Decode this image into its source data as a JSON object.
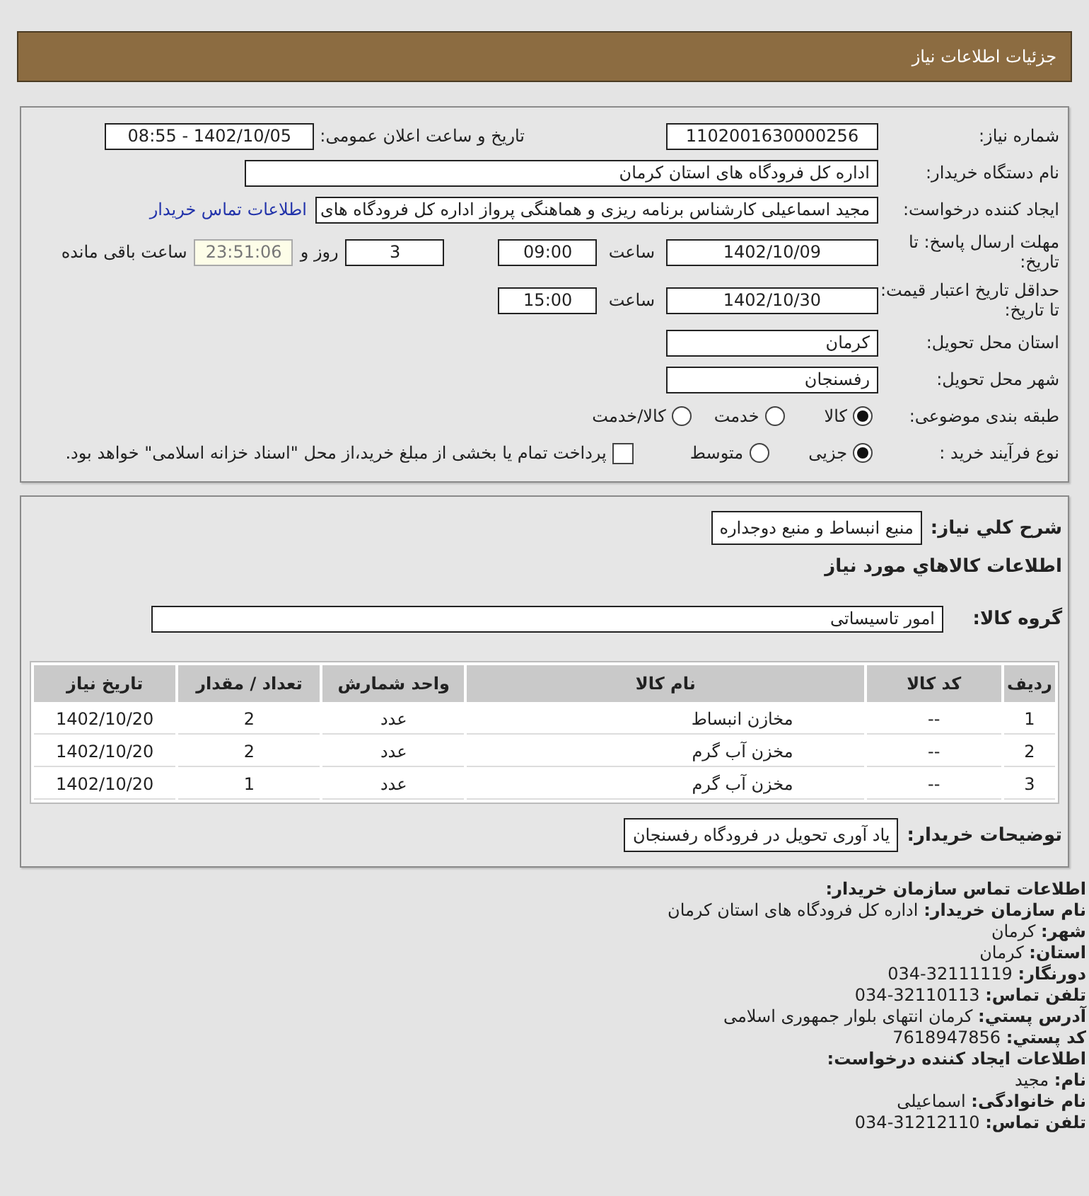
{
  "header": {
    "title": "جزئیات اطلاعات نیاز"
  },
  "details": {
    "need_number": {
      "label": "شماره نیاز:",
      "value": "1102001630000256"
    },
    "announce": {
      "label": "تاریخ و ساعت اعلان عمومی:",
      "value": "1402/10/05 - 08:55"
    },
    "buyer_org": {
      "label": "نام دستگاه خریدار:",
      "value": "اداره کل فرودگاه های استان کرمان"
    },
    "creator": {
      "label": "ایجاد کننده درخواست:",
      "value": "مجید اسماعیلی کارشناس برنامه ریزی و هماهنگی پرواز اداره کل فرودگاه های",
      "link": "اطلاعات تماس خریدار"
    },
    "deadline": {
      "label": "مهلت ارسال پاسخ: تا تاریخ:",
      "date": "1402/10/09",
      "time_label": "ساعت",
      "time": "09:00",
      "days": "3",
      "days_label": "روز و",
      "remaining": "23:51:06",
      "remaining_label": "ساعت باقی مانده"
    },
    "validity": {
      "label": "حداقل تاریخ اعتبار قیمت: تا تاریخ:",
      "date": "1402/10/30",
      "time_label": "ساعت",
      "time": "15:00"
    },
    "province": {
      "label": "استان محل تحویل:",
      "value": "کرمان"
    },
    "city": {
      "label": "شهر محل تحویل:",
      "value": "رفسنجان"
    },
    "category": {
      "label": "طبقه بندی موضوعی:",
      "options": [
        {
          "label": "کالا",
          "selected": true
        },
        {
          "label": "خدمت",
          "selected": false
        },
        {
          "label": "کالا/خدمت",
          "selected": false
        }
      ]
    },
    "process": {
      "label": "نوع فرآیند خرید :",
      "options": [
        {
          "label": "جزیی",
          "selected": true
        },
        {
          "label": "متوسط",
          "selected": false
        }
      ],
      "payment": {
        "checked": false,
        "text": "پرداخت تمام یا بخشی از مبلغ خرید،از محل \"اسناد خزانه اسلامی\" خواهد بود."
      }
    }
  },
  "goods": {
    "summary": {
      "label": "شرح کلي نياز:",
      "value": "منبع انبساط و منبع دوجداره"
    },
    "heading": "اطلاعات كالاهاي مورد نياز",
    "group": {
      "label": "گروه کالا:",
      "value": "امور تاسیساتی"
    },
    "table": {
      "columns": [
        "ردیف",
        "کد کالا",
        "نام کالا",
        "واحد شمارش",
        "تعداد / مقدار",
        "تاریخ نیاز"
      ],
      "rows": [
        [
          "1",
          "--",
          "مخازن انبساط",
          "عدد",
          "2",
          "1402/10/20"
        ],
        [
          "2",
          "--",
          "مخزن آب گرم",
          "عدد",
          "2",
          "1402/10/20"
        ],
        [
          "3",
          "--",
          "مخزن آب گرم",
          "عدد",
          "1",
          "1402/10/20"
        ]
      ]
    },
    "buyer_notes": {
      "label": "توضیحات خریدار:",
      "value": "یاد آوری تحویل در فرودگاه رفسنجان"
    }
  },
  "contact": {
    "heading": "اطلاعات تماس سازمان خریدار:",
    "lines": [
      {
        "label": "نام سازمان خریدار:",
        "value": "اداره کل فرودگاه های استان کرمان"
      },
      {
        "label": "شهر:",
        "value": "کرمان"
      },
      {
        "label": "استان:",
        "value": "کرمان"
      },
      {
        "label": "دورنگار:",
        "value": "32111119-034"
      },
      {
        "label": "تلفن تماس:",
        "value": "32110113-034"
      },
      {
        "label": "آدرس پستي:",
        "value": "کرمان انتهای بلوار جمهوری اسلامی"
      },
      {
        "label": "کد پستي:",
        "value": "7618947856"
      }
    ],
    "creator_heading": "اطلاعات ایجاد کننده درخواست:",
    "creator_lines": [
      {
        "label": "نام:",
        "value": "مجید"
      },
      {
        "label": "نام خانوادگی:",
        "value": "اسماعیلی"
      },
      {
        "label": "تلفن تماس:",
        "value": "31212110-034"
      }
    ]
  }
}
